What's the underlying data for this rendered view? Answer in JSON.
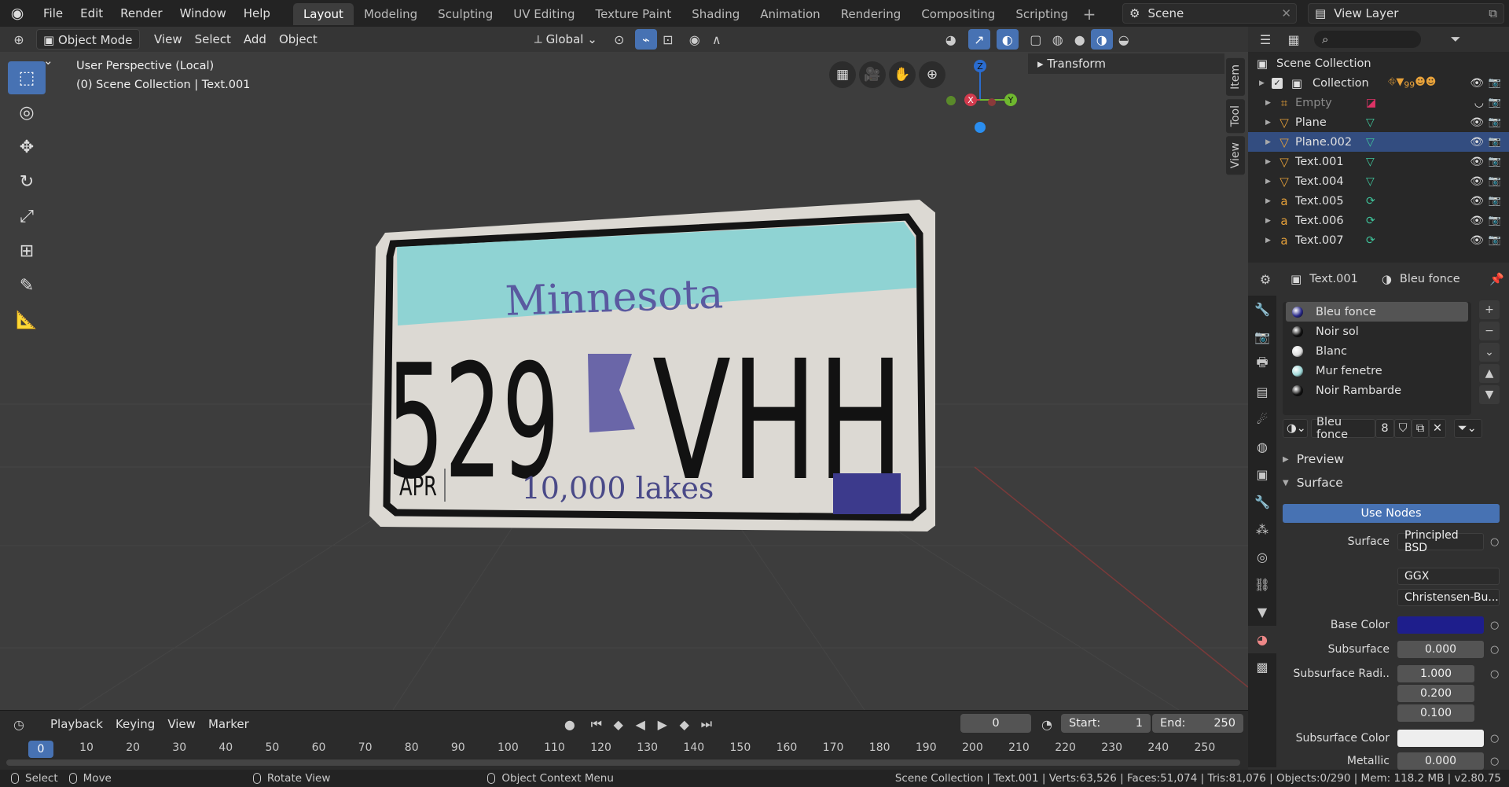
{
  "menu": [
    "File",
    "Edit",
    "Render",
    "Window",
    "Help"
  ],
  "workspaces": [
    "Layout",
    "Modeling",
    "Sculpting",
    "UV Editing",
    "Texture Paint",
    "Shading",
    "Animation",
    "Rendering",
    "Compositing",
    "Scripting"
  ],
  "active_workspace": "Layout",
  "scene": "Scene",
  "view_layer": "View Layer",
  "viewport": {
    "mode": "Object Mode",
    "menus": [
      "View",
      "Select",
      "Add",
      "Object"
    ],
    "orientation": "Global",
    "info_line1": "User Perspective (Local)",
    "info_line2": "(0) Scene Collection | Text.001",
    "transform_panel": "Transform",
    "side_tabs": [
      "Item",
      "Tool",
      "View"
    ],
    "gizmo_labels": {
      "x": "X",
      "y": "Y",
      "z": "Z"
    }
  },
  "plate": {
    "state": "Minnesota",
    "number_left": "529",
    "number_right": "VHH",
    "month": "APR",
    "slogan": "10,000 lakes",
    "colors": {
      "band": "#8fd3d3",
      "plate": "#e5e2dc",
      "text": "#111111",
      "slogan": "#50508a",
      "sticker": "#3a3a8a",
      "flag": "#6060a0"
    }
  },
  "timeline": {
    "menus": [
      "Playback",
      "Keying",
      "View",
      "Marker"
    ],
    "current_frame": "0",
    "start_label": "Start:",
    "start": "1",
    "end_label": "End:",
    "end": "250",
    "ticks": [
      "0",
      "10",
      "20",
      "30",
      "40",
      "50",
      "60",
      "70",
      "80",
      "90",
      "100",
      "110",
      "120",
      "130",
      "140",
      "150",
      "160",
      "170",
      "180",
      "190",
      "200",
      "210",
      "220",
      "230",
      "240",
      "250"
    ]
  },
  "statusbar": {
    "select": "Select",
    "move": "Move",
    "rotate": "Rotate View",
    "context": "Object Context Menu",
    "stats": "Scene Collection | Text.001 | Verts:63,526 | Faces:51,074 | Tris:81,076 | Objects:0/290 | Mem: 118.2 MB | v2.80.75"
  },
  "outliner": {
    "root": "Scene Collection",
    "collection": "Collection",
    "collection_badge": "99",
    "empty_badge": "5",
    "items": [
      {
        "name": "Empty",
        "type": "empty",
        "dim": true
      },
      {
        "name": "Plane",
        "type": "mesh"
      },
      {
        "name": "Plane.002",
        "type": "mesh",
        "selected": true
      },
      {
        "name": "Text.001",
        "type": "mesh"
      },
      {
        "name": "Text.004",
        "type": "mesh"
      },
      {
        "name": "Text.005",
        "type": "text"
      },
      {
        "name": "Text.006",
        "type": "text"
      },
      {
        "name": "Text.007",
        "type": "text"
      }
    ]
  },
  "properties": {
    "object": "Text.001",
    "material": "Bleu fonce",
    "slots": [
      {
        "name": "Bleu fonce",
        "color": "#2a2a8a"
      },
      {
        "name": "Noir sol",
        "color": "#111111"
      },
      {
        "name": "Blanc",
        "color": "#dddddd"
      },
      {
        "name": "Mur fenetre",
        "color": "#9fd8d8"
      },
      {
        "name": "Noir Rambarde",
        "color": "#111111"
      }
    ],
    "users": "8",
    "preview": "Preview",
    "surface_section": "Surface",
    "use_nodes": "Use Nodes",
    "surface_label": "Surface",
    "surface_value": "Principled BSD",
    "distribution": "GGX",
    "subsurface_method": "Christensen-Bu...",
    "base_color_label": "Base Color",
    "base_color": "#1e1e8c",
    "subsurface_label": "Subsurface",
    "subsurface": "0.000",
    "subsurface_radius_label": "Subsurface Radi..",
    "radius": [
      "1.000",
      "0.200",
      "0.100"
    ],
    "subsurface_color_label": "Subsurface Color",
    "subsurface_color": "#eeeeee",
    "metallic_label": "Metallic",
    "metallic": "0.000"
  }
}
